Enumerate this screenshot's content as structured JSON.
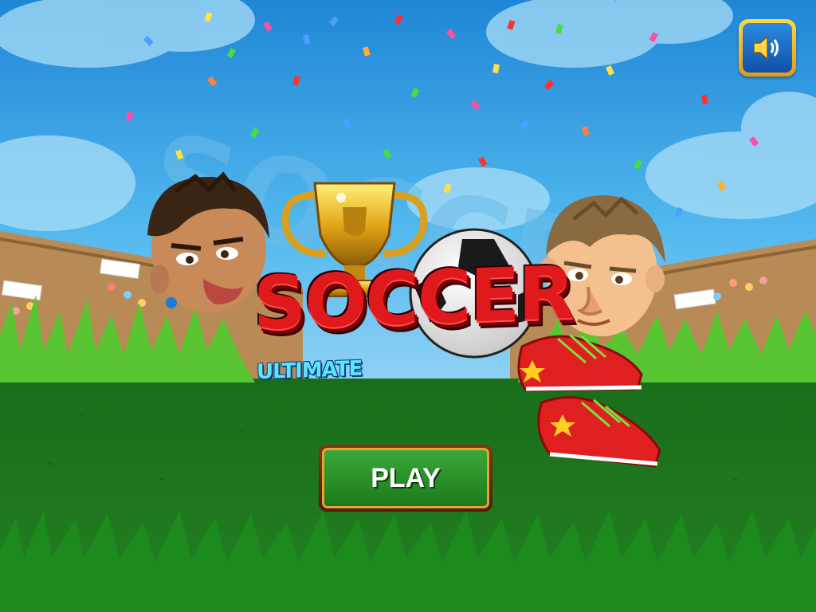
{
  "game": {
    "title": "SOCCER",
    "subtitle": "ULTIMATE"
  },
  "buttons": {
    "play_label": "PLAY",
    "sound_icon": "speaker-volume-icon"
  },
  "colors": {
    "sky": "#3fa9e8",
    "grass": "#1f7a1f",
    "title_red": "#e0191d",
    "subtitle_cyan": "#5fe3ff",
    "play_green": "#2e9a2c",
    "play_border": "#f0a030",
    "sound_gold": "#f5b820",
    "sound_blue": "#1a6cc8"
  }
}
